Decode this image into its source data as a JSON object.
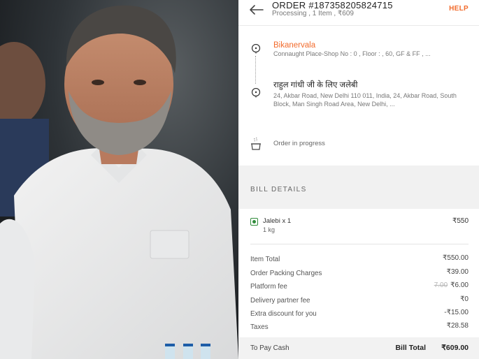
{
  "header": {
    "order_title": "ORDER #187358205824715",
    "order_subtitle": "Processing , 1 Item , ₹609",
    "help_label": "HELP"
  },
  "pickup": {
    "name": "Bikanervala",
    "address": "Connaught Place-Shop No : 0 , Floor : , 60, GF & FF , ..."
  },
  "delivery": {
    "name": "राहुल गांधी जी के लिए जलेबी",
    "address": "24, Akbar Road, New Delhi 110 011, India, 24, Akbar Road, South Block, Man Singh Road Area, New Delhi, ..."
  },
  "status_text": "Order in progress",
  "bill": {
    "heading": "BILL DETAILS",
    "item": {
      "name": "Jalebi x 1",
      "qty": "1 kg",
      "price": "₹550"
    },
    "rows": [
      {
        "label": "Item Total",
        "value": "₹550.00"
      },
      {
        "label": "Order Packing Charges",
        "value": "₹39.00"
      },
      {
        "label": "Platform fee",
        "old": "7.00",
        "value": "₹6.00"
      },
      {
        "label": "Delivery partner fee",
        "value": "₹0"
      },
      {
        "label": "Extra discount for you",
        "value": "-₹15.00"
      },
      {
        "label": "Taxes",
        "value": "₹28.58"
      }
    ],
    "pay_mode": "To Pay Cash",
    "total_label": "Bill Total",
    "total_value": "₹609.00"
  },
  "colors": {
    "accent": "#f26b2c",
    "veg": "#2f8b3a"
  },
  "icons": [
    "back-arrow-icon",
    "location-pin-icon",
    "cooking-pot-icon",
    "veg-indicator-icon"
  ]
}
